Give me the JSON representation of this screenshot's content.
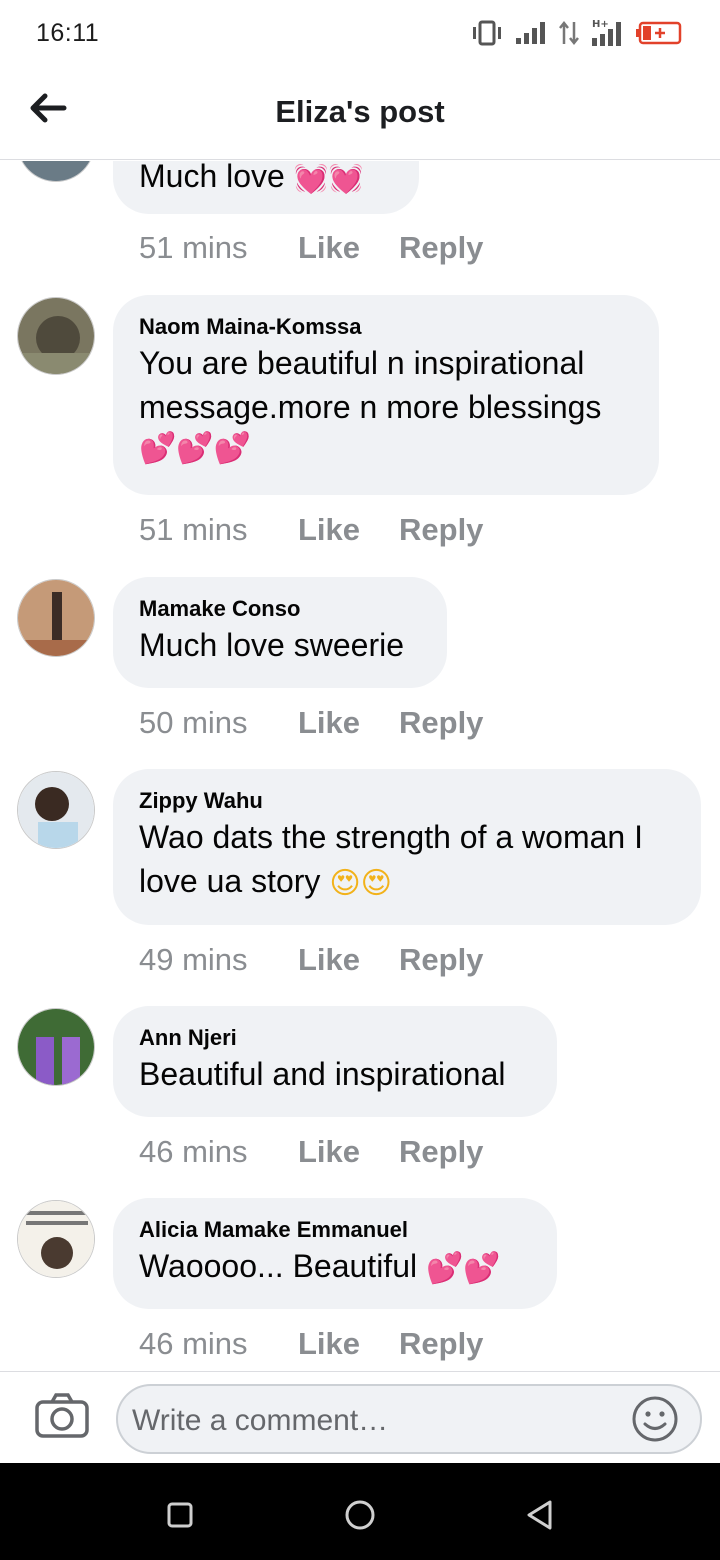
{
  "status_bar": {
    "time": "16:11"
  },
  "header": {
    "title": "Eliza's post"
  },
  "comments": [
    {
      "author": "",
      "lines": [
        "Much love "
      ],
      "emoji": "💓💓",
      "time": "51 mins",
      "like": "Like",
      "reply": "Reply"
    },
    {
      "author": "Naom Maina-Komssa",
      "lines": [
        "You are beautiful n inspirational",
        "message.more n more blessings"
      ],
      "emoji": "💕💕💕",
      "time": "51 mins",
      "like": "Like",
      "reply": "Reply"
    },
    {
      "author": "Mamake Conso",
      "lines": [
        "Much love sweerie"
      ],
      "emoji": "",
      "time": "50 mins",
      "like": "Like",
      "reply": "Reply"
    },
    {
      "author": "Zippy Wahu",
      "lines": [
        "Wao dats the strength of a woman I",
        "love ua story "
      ],
      "emoji": "😍😍",
      "time": "49 mins",
      "like": "Like",
      "reply": "Reply"
    },
    {
      "author": "Ann Njeri",
      "lines": [
        "Beautiful and inspirational"
      ],
      "emoji": "",
      "time": "46 mins",
      "like": "Like",
      "reply": "Reply"
    },
    {
      "author": "Alicia Mamake Emmanuel",
      "lines": [
        "Waoooo... Beautiful "
      ],
      "emoji": "💕💕",
      "time": "46 mins",
      "like": "Like",
      "reply": "Reply"
    }
  ],
  "composer": {
    "placeholder": "Write a comment…"
  },
  "colors": {
    "bubble": "#f0f2f5",
    "meta": "#8a8d91",
    "heart": "#e8263c"
  },
  "icons": [
    "back-arrow-icon",
    "camera-icon",
    "smiley-icon",
    "recents-icon",
    "home-icon",
    "back-icon"
  ]
}
